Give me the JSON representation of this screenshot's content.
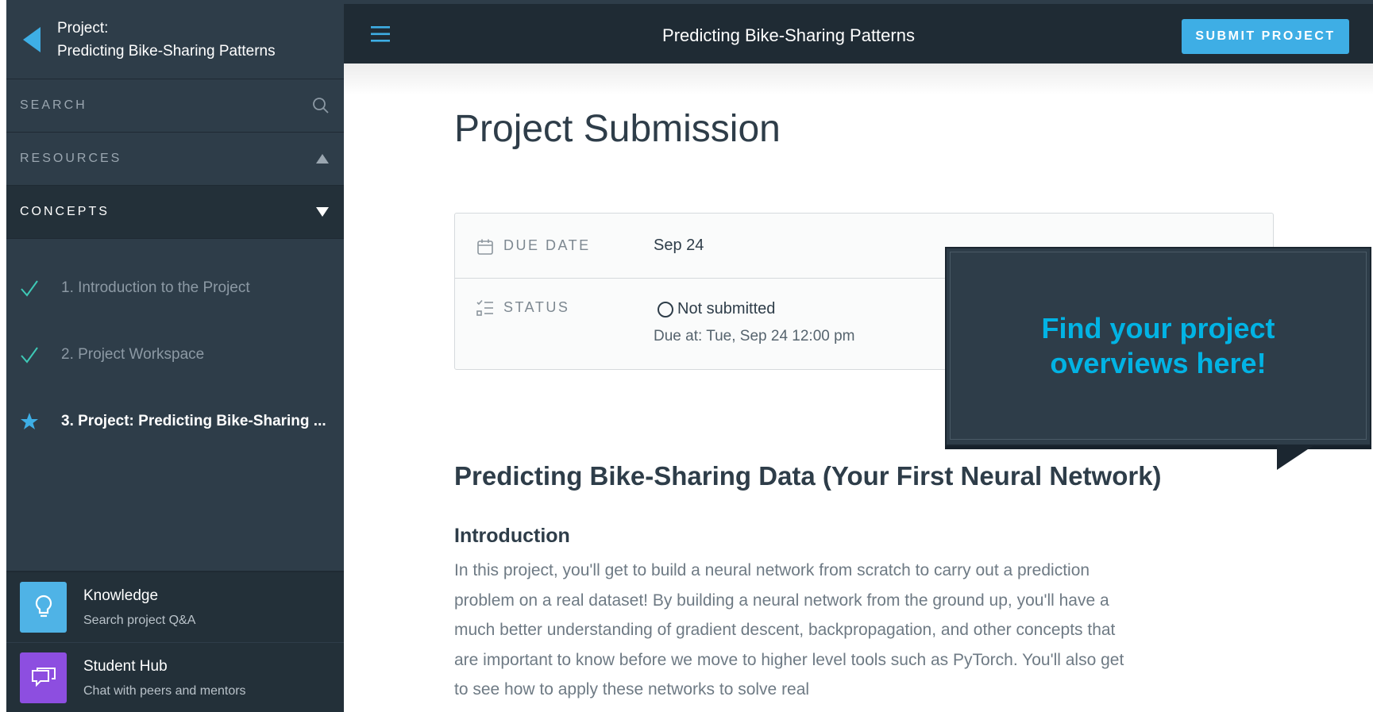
{
  "sidebar": {
    "project_label": "Project:",
    "project_name": "Predicting Bike-Sharing Patterns",
    "search_placeholder": "SEARCH",
    "resources_label": "RESOURCES",
    "concepts_label": "CONCEPTS",
    "lessons": [
      {
        "label": "1. Introduction to the Project",
        "state": "done"
      },
      {
        "label": "2. Project Workspace",
        "state": "done"
      },
      {
        "label": "3. Project: Predicting Bike-Sharing ...",
        "state": "current"
      }
    ],
    "cards": [
      {
        "title": "Knowledge",
        "subtitle": "Search project Q&A",
        "icon": "lightbulb-icon",
        "color": "#4fb3e6"
      },
      {
        "title": "Student Hub",
        "subtitle": "Chat with peers and mentors",
        "icon": "chat-icon",
        "color": "#8d4ee0"
      }
    ]
  },
  "topbar": {
    "title": "Predicting Bike-Sharing Patterns",
    "submit_label": "SUBMIT PROJECT"
  },
  "main": {
    "title": "Project Submission",
    "due_date_label": "DUE DATE",
    "due_date_value": "Sep 24",
    "status_label": "STATUS",
    "status_value": "Not submitted",
    "due_at": "Due at: Tue, Sep 24 12:00 pm",
    "section_title": "Predicting Bike-Sharing Data (Your First Neural Network)",
    "intro_heading": "Introduction",
    "intro_text": "In this project, you'll get to build a neural network from scratch to carry out a prediction problem on a real dataset! By building a neural network from the ground up, you'll have a much better understanding of gradient descent, backpropagation, and other concepts that are important to know before we move to higher level tools such as PyTorch. You'll also get to see how to apply these networks to solve real"
  },
  "tooltip": {
    "text": "Find your project overviews here!"
  },
  "colors": {
    "accent": "#02b3e4",
    "button": "#3eaee5",
    "sidebar_bg": "#2e3d49",
    "topbar_bg": "#1f2b34"
  }
}
